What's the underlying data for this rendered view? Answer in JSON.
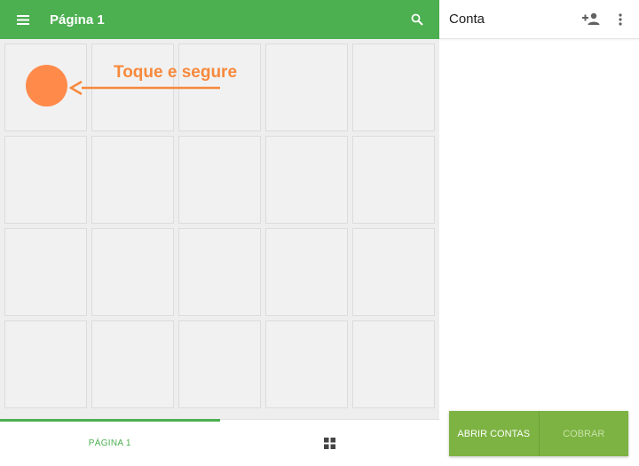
{
  "appbar": {
    "title": "Página 1"
  },
  "hint": {
    "text": "Toque e segure"
  },
  "grid": {
    "rows": 4,
    "cols": 5
  },
  "bottom_tabs": [
    {
      "label": "PÁGINA 1",
      "active": true
    },
    {
      "label": "",
      "icon": "grid-icon",
      "active": false
    }
  ],
  "account": {
    "title": "Conta"
  },
  "actions": {
    "open_label": "ABRIR CONTAS",
    "charge_label": "COBRAR"
  },
  "colors": {
    "primary": "#4caf50",
    "accent": "#7cb342",
    "hint": "#ff8a4a"
  }
}
